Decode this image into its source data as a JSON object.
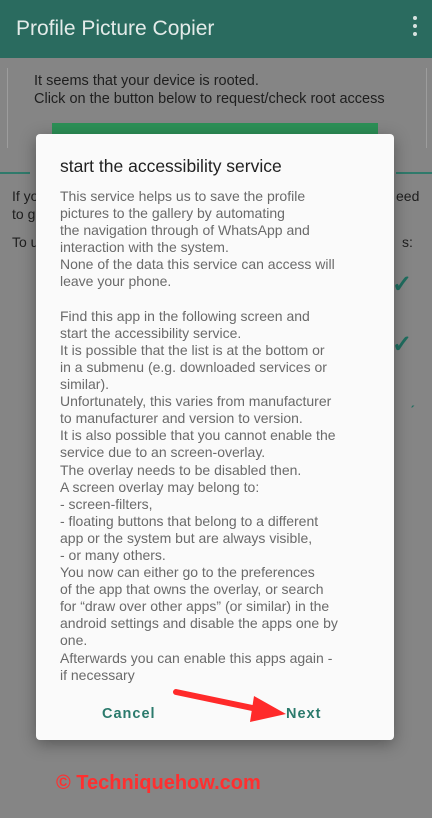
{
  "app": {
    "title": "Profile Picture Copier"
  },
  "background": {
    "root_message_line1": "It seems that your device is rooted.",
    "root_message_line2": "Click on the button below to request/check root access",
    "left_fragment1": "If yo",
    "left_fragment2": "to g",
    "left_fragment3": "To u",
    "right_fragment1": "eed",
    "right_fragment2": "s:"
  },
  "dialog": {
    "title": "start the accessibility service",
    "body": "This service helps us to save the profile\npictures to the gallery by automating\nthe navigation through of WhatsApp and\ninteraction with the system.\nNone of the data this service can access will\nleave your phone.\n\nFind this app in the following screen and\nstart the accessibility service.\nIt is possible that the list is at the bottom or\nin a submenu (e.g. downloaded services or\nsimilar).\nUnfortunately, this varies from manufacturer\nto manufacturer and version to version.\nIt is also possible that you cannot enable the\nservice due to an screen-overlay.\nThe overlay needs to be disabled then.\nA screen overlay may belong to:\n - screen-filters,\n - floating buttons that belong to a different\napp or the system but are always visible,\n - or many others.\nYou now can either go to the preferences\nof the app that owns the overlay, or search\nfor “draw over other apps” (or similar) in the\nandroid settings and disable the apps one by\none.\nAfterwards you can enable this apps again -\nif necessary",
    "cancel_label": "Cancel",
    "next_label": "Next"
  },
  "watermark": "© Techniquehow.com",
  "colors": {
    "appbar": "#2a6b5f",
    "accent": "#2b7a6c",
    "annotation": "#ff2f2f"
  }
}
